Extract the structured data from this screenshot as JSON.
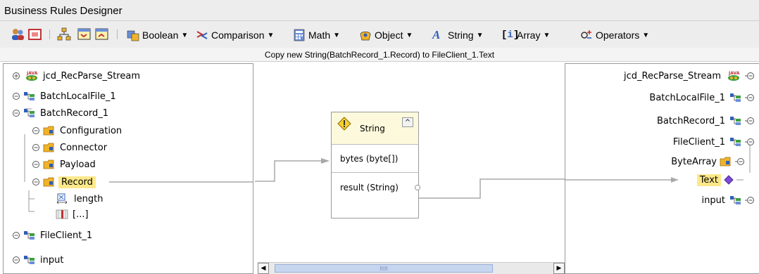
{
  "window": {
    "title": "Business Rules Designer"
  },
  "toolbar": {
    "menus": [
      {
        "label": "Boolean"
      },
      {
        "label": "Comparison"
      },
      {
        "label": "Math"
      },
      {
        "label": "Object"
      },
      {
        "label": "String"
      },
      {
        "label": "Array"
      },
      {
        "label": "Operators"
      }
    ],
    "dropdown_glyph": "▼"
  },
  "status": {
    "text": "Copy new String(BatchRecord_1.Record) to FileClient_1.Text"
  },
  "left_tree": {
    "nodes": [
      {
        "label": "jcd_RecParse_Stream"
      },
      {
        "label": "BatchLocalFile_1"
      },
      {
        "label": "BatchRecord_1"
      },
      {
        "label": "Configuration"
      },
      {
        "label": "Connector"
      },
      {
        "label": "Payload"
      },
      {
        "label": "Record"
      },
      {
        "label": "length"
      },
      {
        "label": "[...]"
      },
      {
        "label": "FileClient_1"
      },
      {
        "label": "input"
      }
    ]
  },
  "method_box": {
    "title": "String",
    "input": "bytes (byte[])",
    "output": "result (String)",
    "collapse_glyph": "^"
  },
  "right_tree": {
    "nodes": [
      {
        "label": "jcd_RecParse_Stream"
      },
      {
        "label": "BatchLocalFile_1"
      },
      {
        "label": "BatchRecord_1"
      },
      {
        "label": "FileClient_1"
      },
      {
        "label": "ByteArray"
      },
      {
        "label": "Text"
      },
      {
        "label": "input"
      }
    ]
  },
  "scroll": {
    "grip": "IIIII"
  },
  "colors": {
    "highlight": "#fde98a",
    "link_line": "#a8a8a8",
    "accent_purple": "#7a4bd6",
    "folder_orange": "#f0b429"
  }
}
